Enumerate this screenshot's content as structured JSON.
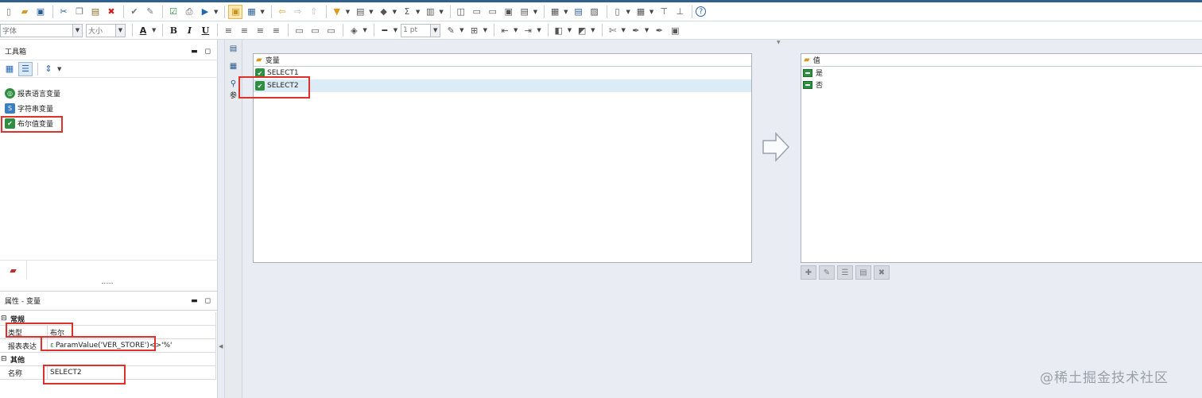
{
  "toolbar_row2": {
    "font_placeholder": "字体",
    "size_placeholder": "大小",
    "bold": "B",
    "italic": "I",
    "underline": "U",
    "line_width": "1 pt"
  },
  "toolbox": {
    "title": "工具箱",
    "items": [
      {
        "label": "报表语言变量",
        "icon": "report-language-variable-icon"
      },
      {
        "label": "字符串变量",
        "icon": "string-variable-icon"
      },
      {
        "label": "布尔值变量",
        "icon": "boolean-variable-icon"
      }
    ]
  },
  "properties": {
    "title": "属性 -  变量",
    "groups": {
      "general": "常规",
      "other": "其他"
    },
    "rows": {
      "type_label": "类型",
      "type_value": "布尔",
      "expr_label": "报表表达",
      "expr_value": "ParamValue('VER_STORE')<>'%'",
      "name_label": "名称",
      "name_value": "SELECT2"
    }
  },
  "variables_list": {
    "header": "变量",
    "items": [
      "SELECT1",
      "SELECT2"
    ],
    "selected": "SELECT2"
  },
  "values_list": {
    "header": "值",
    "items": [
      "是",
      "否"
    ]
  },
  "side_strip_label": "参",
  "watermark": "@稀土掘金技术社区",
  "colors": {
    "accent": "#2d5f8f",
    "highlight_box": "#e0302a",
    "selection": "#dcecf6",
    "boolean_green": "#2f8f41"
  }
}
